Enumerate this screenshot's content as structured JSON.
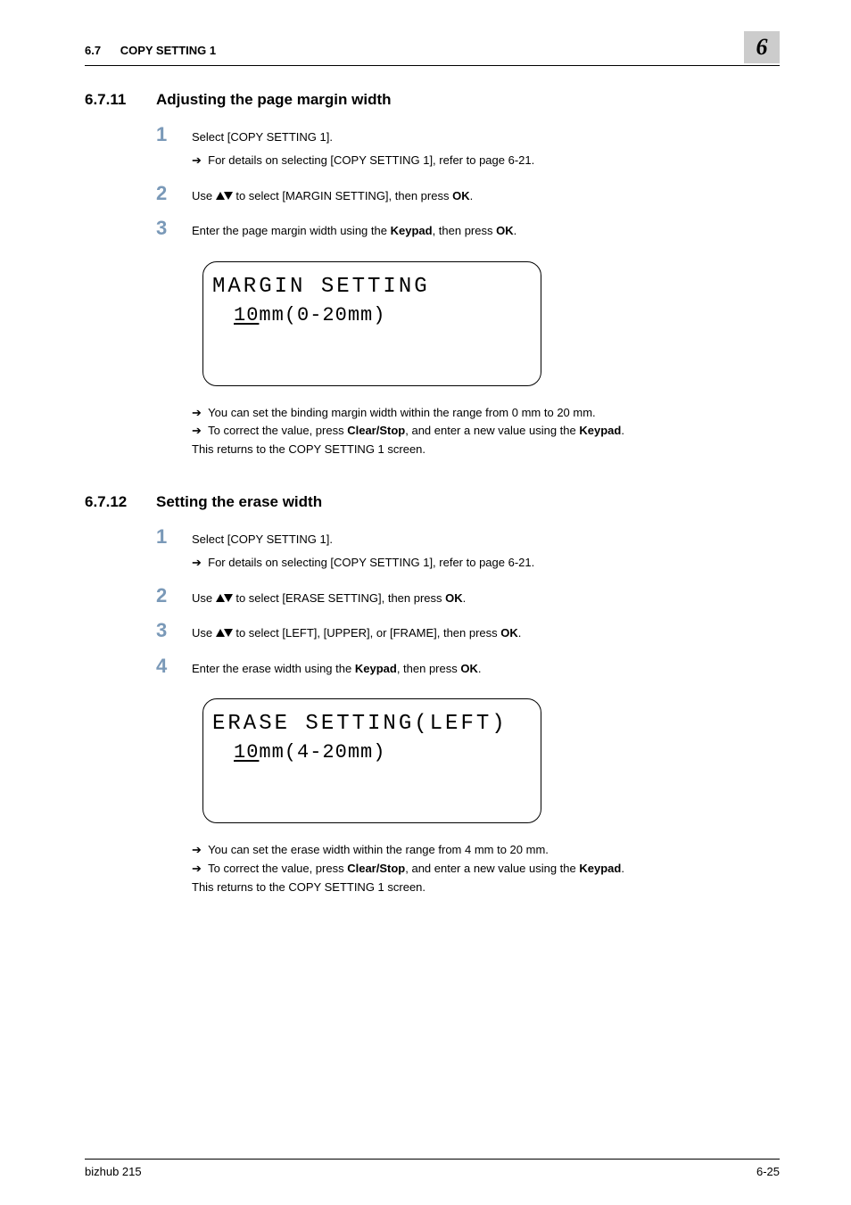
{
  "header": {
    "section_num": "6.7",
    "section_title": "COPY SETTING 1",
    "chapter_num": "6"
  },
  "section_a": {
    "num": "6.7.11",
    "title": "Adjusting the page margin width",
    "step1_num": "1",
    "step1_text": "Select [COPY SETTING 1].",
    "step1_note": "For details on selecting [COPY SETTING 1], refer to page 6-21.",
    "step2_num": "2",
    "step2_use": "Use ",
    "step2_rest": " to select [MARGIN SETTING], then press ",
    "step2_ok": "OK",
    "step2_period": ".",
    "step3_num": "3",
    "step3_a": "Enter the page margin width using the ",
    "step3_keypad": "Keypad",
    "step3_b": ", then press ",
    "step3_ok": "OK",
    "step3_c": ".",
    "lcd_line1": "MARGIN SETTING",
    "lcd_val": "10",
    "lcd_rest": "mm(0-20mm)",
    "post1": "You can set the binding margin width within the range from 0 mm to 20 mm.",
    "post2a": "To correct the value, press ",
    "post2b": "Clear/Stop",
    "post2c": ", and enter a new value using the ",
    "post2d": "Keypad",
    "post2e": ".",
    "post3": "This returns to the COPY SETTING 1 screen."
  },
  "section_b": {
    "num": "6.7.12",
    "title": "Setting the erase width",
    "step1_num": "1",
    "step1_text": "Select [COPY SETTING 1].",
    "step1_note": "For details on selecting [COPY SETTING 1], refer to page 6-21.",
    "step2_num": "2",
    "step2_use": "Use ",
    "step2_rest": " to select [ERASE SETTING], then press ",
    "step2_ok": "OK",
    "step2_period": ".",
    "step3_num": "3",
    "step3_use": "Use ",
    "step3_rest": " to select [LEFT], [UPPER], or [FRAME], then press ",
    "step3_ok": "OK",
    "step3_period": ".",
    "step4_num": "4",
    "step4_a": "Enter the erase width using the ",
    "step4_keypad": "Keypad",
    "step4_b": ", then press ",
    "step4_ok": "OK",
    "step4_c": ".",
    "lcd_line1": "ERASE SETTING(LEFT)",
    "lcd_val": "10",
    "lcd_rest": "mm(4-20mm)",
    "post1": "You can set the erase width within the range from 4 mm to 20 mm.",
    "post2a": "To correct the value, press ",
    "post2b": "Clear/Stop",
    "post2c": ", and enter a new value using the ",
    "post2d": "Keypad",
    "post2e": ".",
    "post3": "This returns to the COPY SETTING 1 screen."
  },
  "footer": {
    "product": "bizhub 215",
    "pagenum": "6-25"
  },
  "arrow": "➔"
}
